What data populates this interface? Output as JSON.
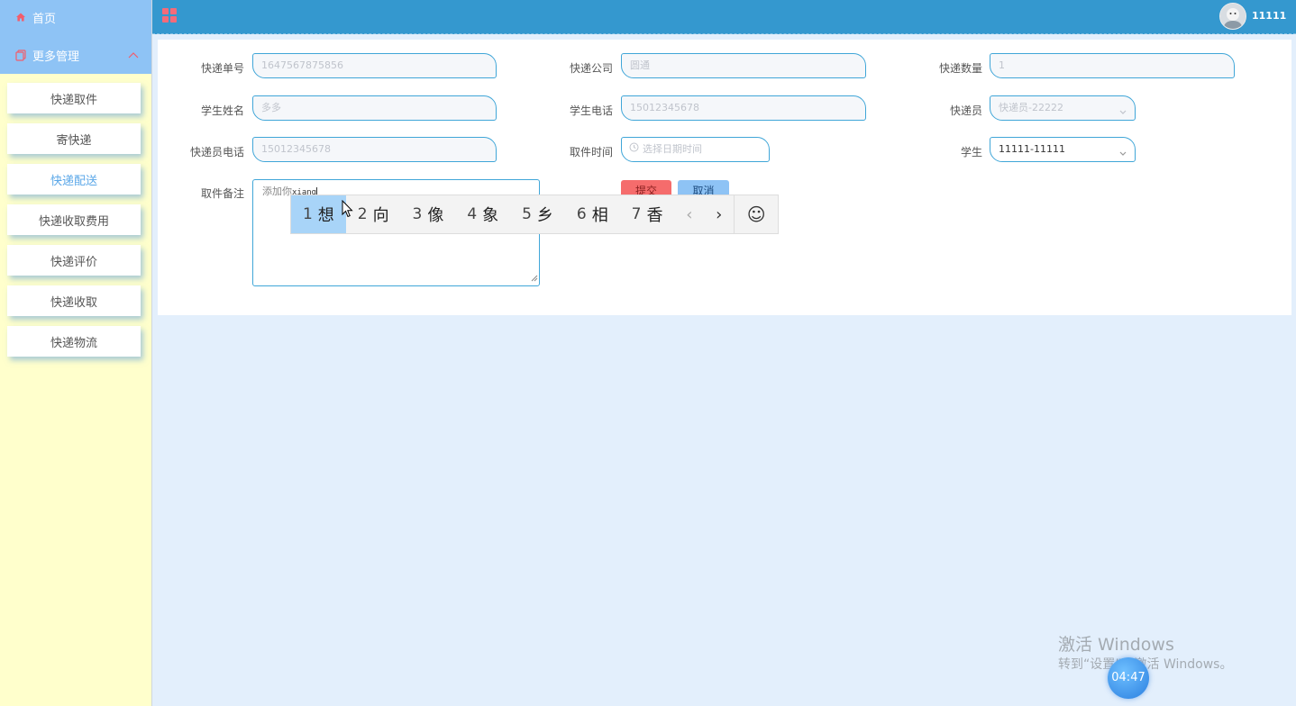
{
  "sidebar": {
    "home_label": "首页",
    "more_label": "更多管理",
    "items": [
      {
        "label": "快递取件"
      },
      {
        "label": "寄快递"
      },
      {
        "label": "快递配送"
      },
      {
        "label": "快递收取费用"
      },
      {
        "label": "快递评价"
      },
      {
        "label": "快递收取"
      },
      {
        "label": "快递物流"
      }
    ]
  },
  "header": {
    "username": "11111"
  },
  "form": {
    "tracking_no": {
      "label": "快递单号",
      "value": "1647567875856"
    },
    "company": {
      "label": "快递公司",
      "value": "圆通"
    },
    "quantity": {
      "label": "快递数量",
      "value": "1"
    },
    "student_name": {
      "label": "学生姓名",
      "value": "多多"
    },
    "student_phone": {
      "label": "学生电话",
      "value": "15012345678"
    },
    "courier": {
      "label": "快递员",
      "value": "快递员-22222"
    },
    "courier_phone": {
      "label": "快递员电话",
      "value": "15012345678"
    },
    "pickup_time": {
      "label": "取件时间",
      "placeholder": "选择日期时间"
    },
    "student": {
      "label": "学生",
      "value": "11111-11111"
    },
    "remark": {
      "label": "取件备注",
      "prefix": "添加你",
      "typed": "xiang"
    },
    "submit_label": "提交",
    "cancel_label": "取消"
  },
  "ime": {
    "candidates": [
      {
        "n": "1",
        "c": "想"
      },
      {
        "n": "2",
        "c": "向"
      },
      {
        "n": "3",
        "c": "像"
      },
      {
        "n": "4",
        "c": "象"
      },
      {
        "n": "5",
        "c": "乡"
      },
      {
        "n": "6",
        "c": "相"
      },
      {
        "n": "7",
        "c": "香"
      }
    ],
    "prev": "‹",
    "next": "›",
    "emoji": "☺"
  },
  "watermark": {
    "line1": "激活 Windows",
    "line2": "转到“设置”以激活 Windows。"
  },
  "clock": "04:47",
  "colors": {
    "header": "#3498cf",
    "sidebar_bg": "#ffffcc",
    "menu_top": "#8ec3f5",
    "accent_active": "#5aa7e8",
    "submit": "#f56c6c",
    "cancel": "#8ec3f5"
  }
}
